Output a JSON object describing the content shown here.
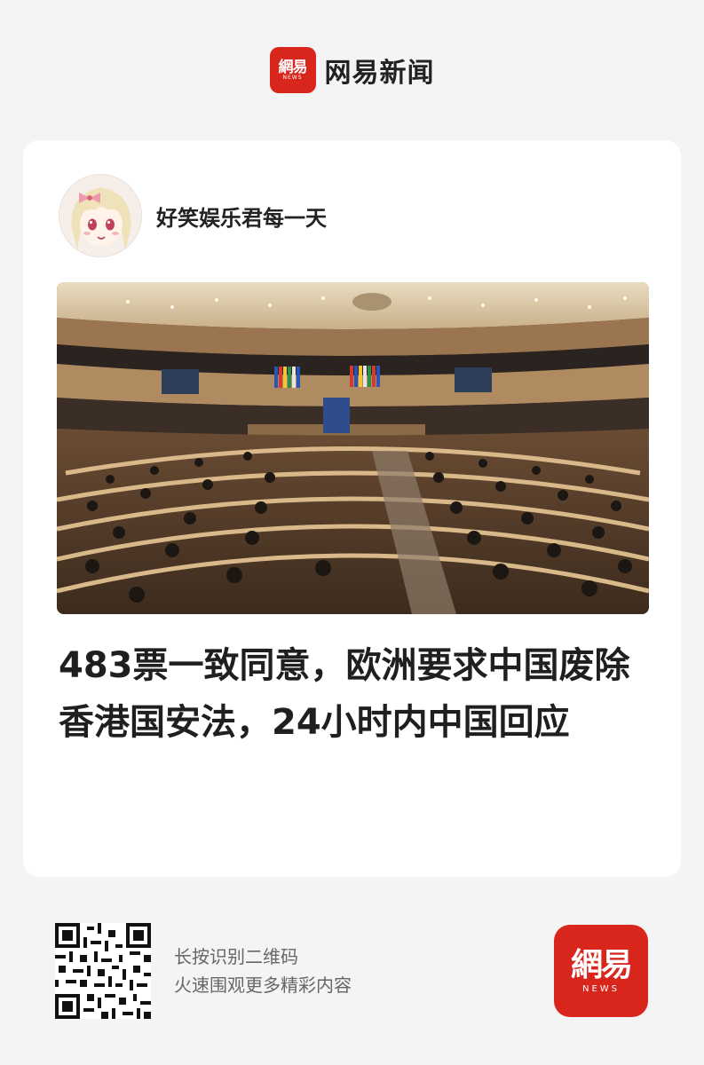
{
  "brand": {
    "logo_glyph": "網易",
    "logo_sub": "NEWS",
    "name": "网易新闻",
    "accent": "#d9261c"
  },
  "author": {
    "name": "好笑娱乐君每一天",
    "avatar_icon": "anime-girl-avatar"
  },
  "article": {
    "headline": "483票一致同意，欧洲要求中国废除香港国安法，24小时内中国回应",
    "image_icon": "parliament-chamber-photo"
  },
  "footer": {
    "line1": "长按识别二维码",
    "line2": "火速围观更多精彩内容",
    "qr_icon": "qr-code-icon"
  }
}
